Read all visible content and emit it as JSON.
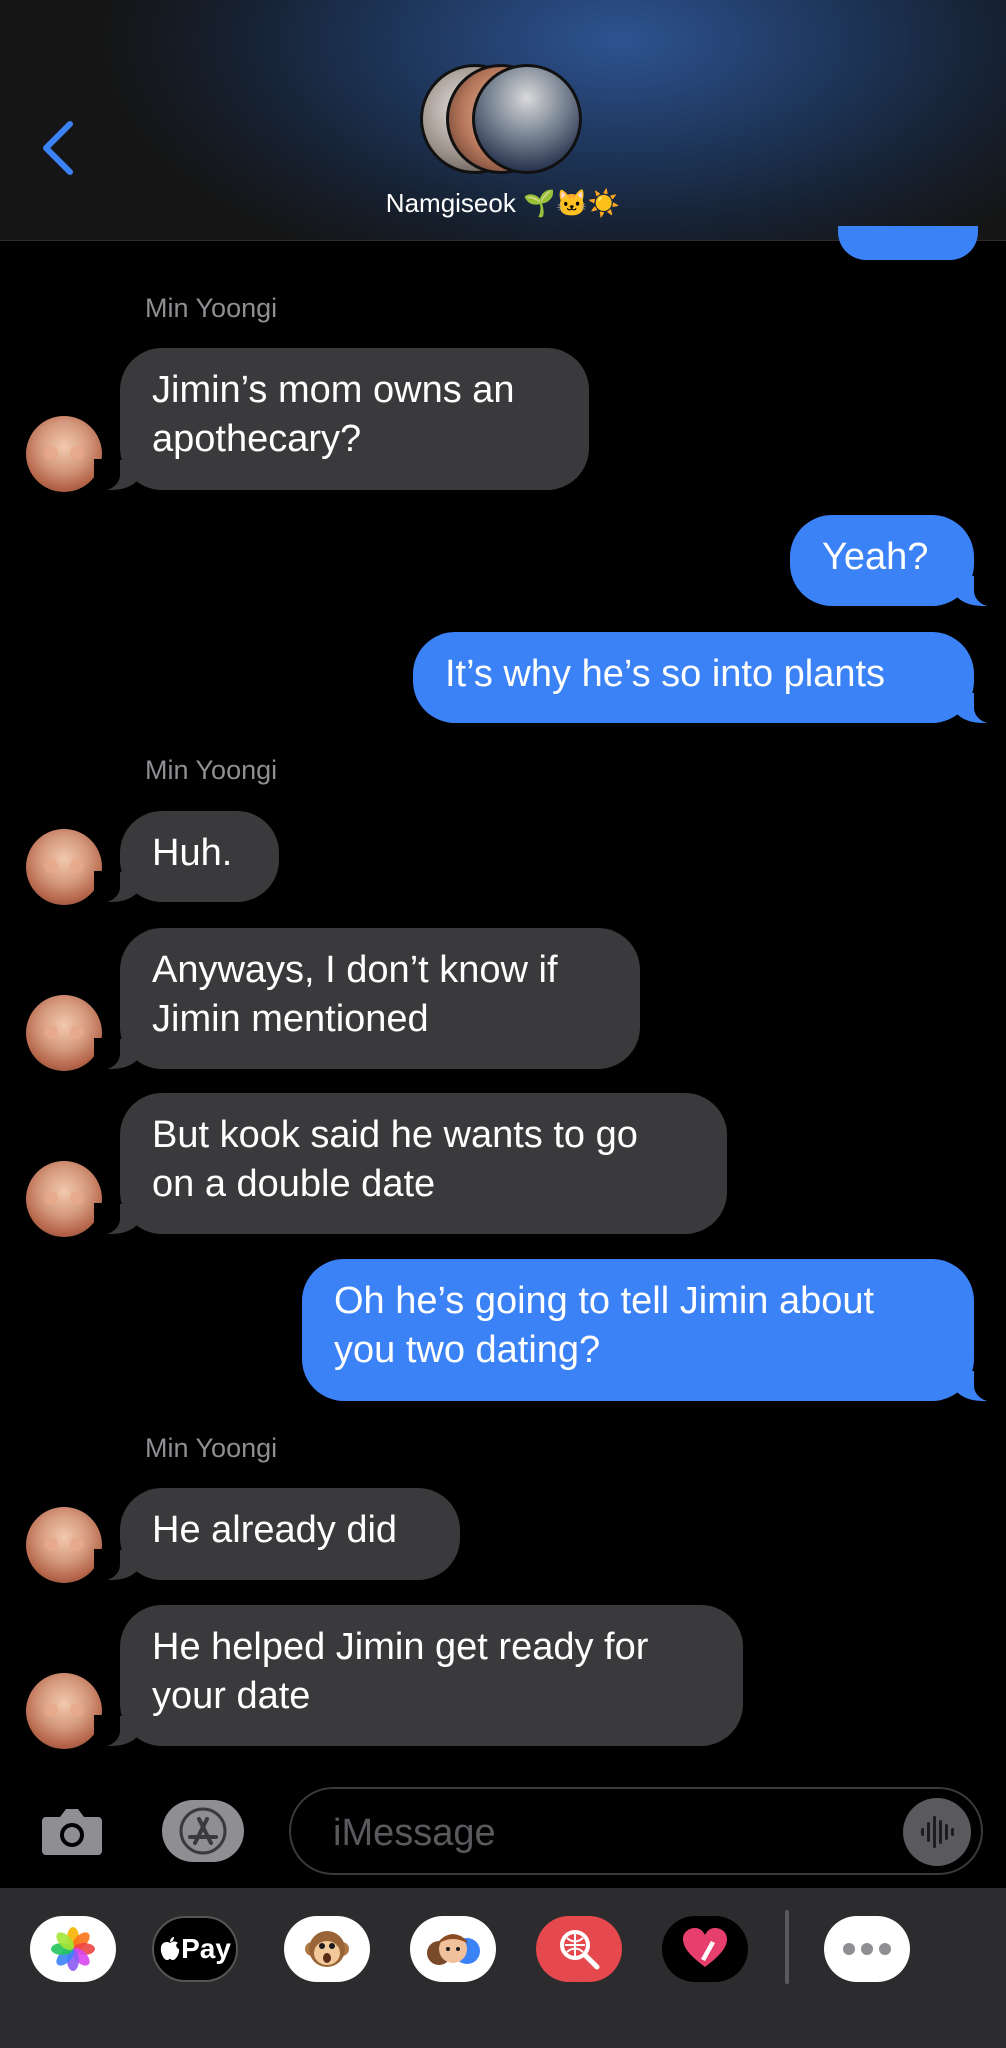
{
  "header": {
    "contact_name": "Namgiseok 🌱🐱☀️"
  },
  "messages": [
    {
      "type": "sender",
      "text": "Min Yoongi"
    },
    {
      "type": "in",
      "lines": [
        "Jimin’s mom owns an",
        "apothecary?"
      ]
    },
    {
      "type": "out",
      "lines": [
        "Yeah?"
      ]
    },
    {
      "type": "out",
      "lines": [
        "It’s why he’s so into plants"
      ]
    },
    {
      "type": "sender",
      "text": "Min Yoongi"
    },
    {
      "type": "in",
      "lines": [
        "Huh."
      ]
    },
    {
      "type": "in",
      "lines": [
        "Anyways, I don’t know if",
        "Jimin mentioned"
      ]
    },
    {
      "type": "in",
      "lines": [
        "But kook said he wants to go",
        "on a double date"
      ]
    },
    {
      "type": "out",
      "lines": [
        "Oh he’s going to tell Jimin about",
        "you two dating?"
      ]
    },
    {
      "type": "sender",
      "text": "Min Yoongi"
    },
    {
      "type": "in",
      "lines": [
        "He already did"
      ]
    },
    {
      "type": "in",
      "lines": [
        "He helped Jimin get ready for",
        "your date"
      ]
    }
  ],
  "input": {
    "placeholder": "iMessage"
  },
  "app_drawer": {
    "apple_pay_label": "Pay",
    "icons": [
      "photos-icon",
      "apple-pay-icon",
      "animoji-icon",
      "memoji-icon",
      "image-search-icon",
      "digital-touch-icon",
      "more-icon"
    ]
  },
  "colors": {
    "outgoing_bubble": "#3b82f6",
    "incoming_bubble": "#3a3a3c",
    "back_chevron": "#3b82f6"
  }
}
